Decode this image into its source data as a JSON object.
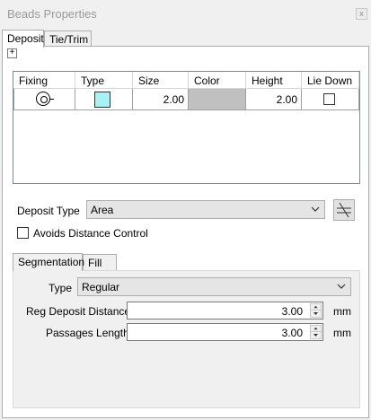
{
  "window": {
    "title": "Beads Properties",
    "close_glyph": "x"
  },
  "tabs": [
    {
      "label": "Deposit"
    },
    {
      "label": "Tie/Trim"
    }
  ],
  "toolbar": {
    "add_symbol": "+"
  },
  "grid": {
    "columns": [
      "Fixing",
      "Type",
      "Size",
      "Color",
      "Height",
      "Lie Down"
    ],
    "rows": [
      {
        "fixing_icon": "fixing-point-icon",
        "type_color": "#a8f2f6",
        "size": "2.00",
        "color": "#c0c0c0",
        "height": "2.00",
        "lie_down": false
      }
    ]
  },
  "deposit_type": {
    "label": "Deposit Type",
    "value": "Area"
  },
  "avoids_distance_control": {
    "label": "Avoids Distance Control",
    "checked": false
  },
  "sub_tabs": [
    {
      "label": "Segmentation"
    },
    {
      "label": "Fill"
    }
  ],
  "segmentation": {
    "type": {
      "label": "Type",
      "value": "Regular"
    },
    "reg_deposit_distance": {
      "label": "Reg Deposit Distance",
      "value": "3.00",
      "unit": "mm"
    },
    "passages_length": {
      "label": "Passages Length",
      "value": "3.00",
      "unit": "mm"
    }
  }
}
